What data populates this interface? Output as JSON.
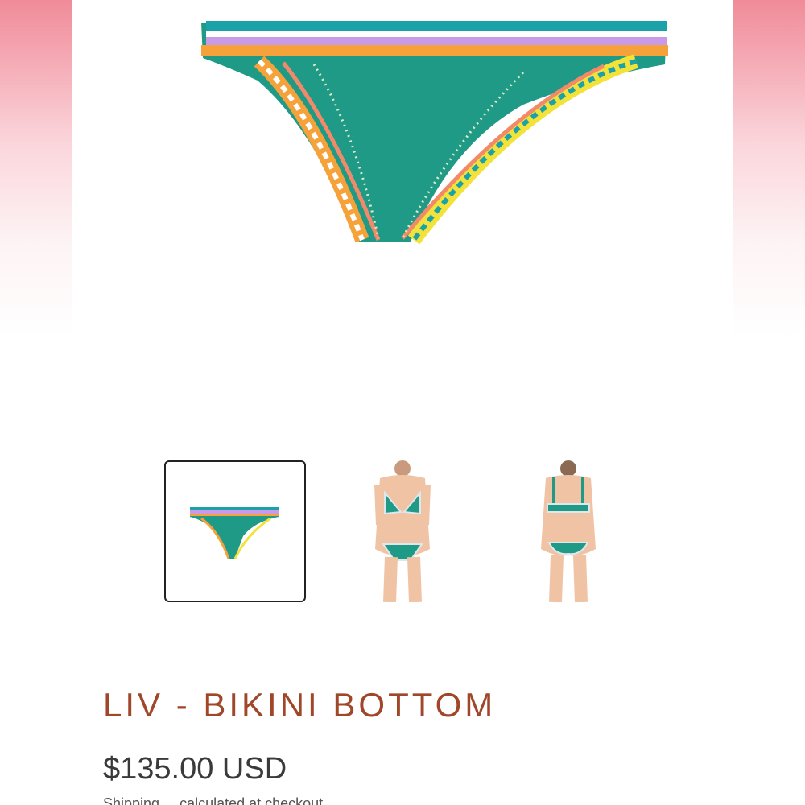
{
  "product": {
    "title": "LIV - BIKINI BOTTOM",
    "price": "$135.00 USD",
    "shipping_note_partial": "Shipping ... calculated at checkout"
  },
  "gallery": {
    "main_image": "bikini-bottom-crochet-icon",
    "thumbnails": [
      {
        "name": "thumb-bottom-flatlay",
        "selected": true
      },
      {
        "name": "thumb-model-front",
        "selected": false
      },
      {
        "name": "thumb-model-back",
        "selected": false
      }
    ]
  },
  "colors": {
    "title": "#a0472a",
    "price": "#3a3a3a",
    "teal": "#1f9a86",
    "border_selected": "#222222",
    "side_pink": "#f08b99"
  }
}
